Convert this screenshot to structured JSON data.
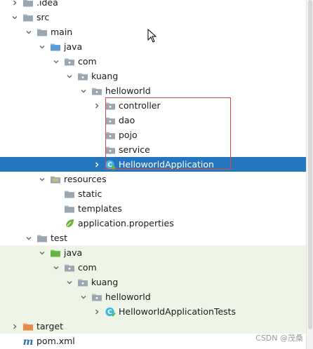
{
  "tree": [
    {
      "label": ".idea",
      "icon": "folder-icon",
      "depth": 0,
      "toggle": "collapsed"
    },
    {
      "label": "src",
      "icon": "folder-icon",
      "depth": 0,
      "toggle": "expanded"
    },
    {
      "label": "main",
      "icon": "folder-icon",
      "depth": 1,
      "toggle": "expanded"
    },
    {
      "label": "java",
      "icon": "source-root-folder-icon",
      "depth": 2,
      "toggle": "expanded"
    },
    {
      "label": "com",
      "icon": "package-icon",
      "depth": 3,
      "toggle": "expanded"
    },
    {
      "label": "kuang",
      "icon": "package-icon",
      "depth": 4,
      "toggle": "expanded"
    },
    {
      "label": "helloworld",
      "icon": "package-icon",
      "depth": 5,
      "toggle": "expanded"
    },
    {
      "label": "controller",
      "icon": "package-icon",
      "depth": 6,
      "toggle": "collapsed"
    },
    {
      "label": "dao",
      "icon": "package-icon",
      "depth": 6,
      "toggle": "none"
    },
    {
      "label": "pojo",
      "icon": "package-icon",
      "depth": 6,
      "toggle": "none"
    },
    {
      "label": "service",
      "icon": "package-icon",
      "depth": 6,
      "toggle": "none"
    },
    {
      "label": "HelloworldApplication",
      "icon": "spring-class-icon",
      "depth": 6,
      "toggle": "collapsed",
      "selected": true
    },
    {
      "label": "resources",
      "icon": "resources-folder-icon",
      "depth": 2,
      "toggle": "expanded"
    },
    {
      "label": "static",
      "icon": "folder-icon",
      "depth": 3,
      "toggle": "none"
    },
    {
      "label": "templates",
      "icon": "folder-icon",
      "depth": 3,
      "toggle": "none"
    },
    {
      "label": "application.properties",
      "icon": "spring-properties-icon",
      "depth": 3,
      "toggle": "none"
    },
    {
      "label": "test",
      "icon": "folder-icon",
      "depth": 1,
      "toggle": "expanded"
    },
    {
      "label": "java",
      "icon": "test-source-folder-icon",
      "depth": 2,
      "toggle": "expanded",
      "test": true
    },
    {
      "label": "com",
      "icon": "package-icon",
      "depth": 3,
      "toggle": "expanded",
      "test": true
    },
    {
      "label": "kuang",
      "icon": "package-icon",
      "depth": 4,
      "toggle": "expanded",
      "test": true
    },
    {
      "label": "helloworld",
      "icon": "package-icon",
      "depth": 5,
      "toggle": "expanded",
      "test": true
    },
    {
      "label": "HelloworldApplicationTests",
      "icon": "test-class-icon",
      "depth": 6,
      "toggle": "collapsed",
      "test": true
    },
    {
      "label": "target",
      "icon": "excluded-folder-icon",
      "depth": 0,
      "toggle": "collapsed",
      "test": true
    },
    {
      "label": "pom.xml",
      "icon": "maven-icon",
      "depth": 0,
      "toggle": "none"
    }
  ],
  "watermark": "CSDN @茂桑",
  "colors": {
    "selection": "#2675bf",
    "test_background": "#eef5e7",
    "highlight_border": "#d9484a"
  }
}
